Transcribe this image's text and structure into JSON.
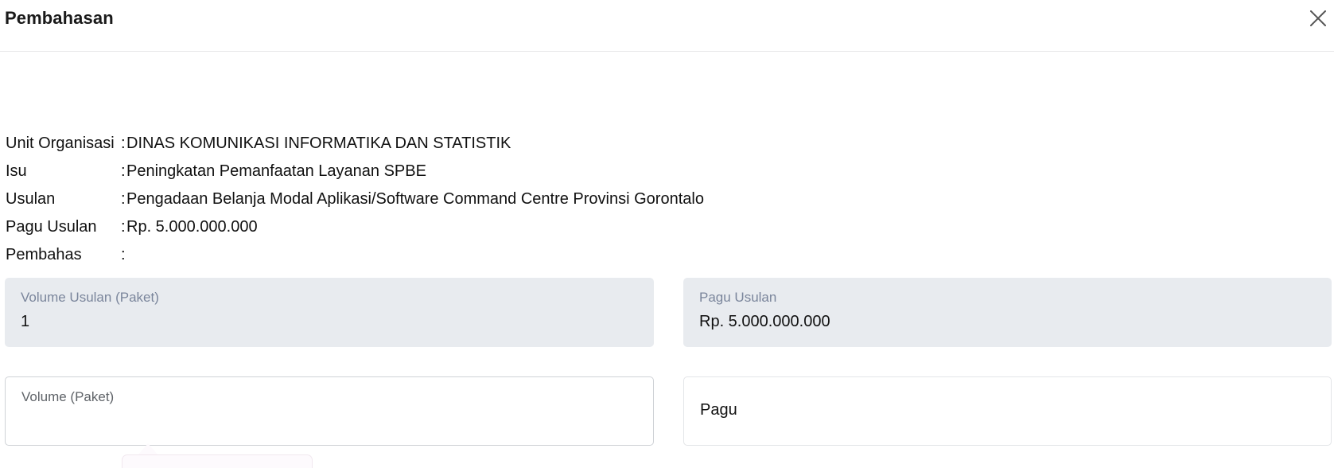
{
  "dialog": {
    "title": "Pembahasan",
    "close_icon": "close-icon"
  },
  "info": {
    "separator": ":",
    "rows": [
      {
        "label": "Unit Organisasi",
        "value": "DINAS KOMUNIKASI INFORMATIKA DAN STATISTIK"
      },
      {
        "label": "Isu",
        "value": "Peningkatan Pemanfaatan Layanan SPBE"
      },
      {
        "label": "Usulan",
        "value": "Pengadaan Belanja Modal Aplikasi/Software Command Centre Provinsi Gorontalo"
      },
      {
        "label": "Pagu Usulan",
        "value": "Rp. 5.000.000.000"
      },
      {
        "label": "Pembahas",
        "value": ""
      }
    ]
  },
  "fields": {
    "volume_usulan": {
      "label": "Volume Usulan (Paket)",
      "value": "1"
    },
    "pagu_usulan": {
      "label": "Pagu Usulan",
      "value": "Rp. 5.000.000.000"
    },
    "volume": {
      "label": "Volume (Paket)",
      "value": ""
    },
    "pagu": {
      "placeholder": "Pagu"
    }
  }
}
